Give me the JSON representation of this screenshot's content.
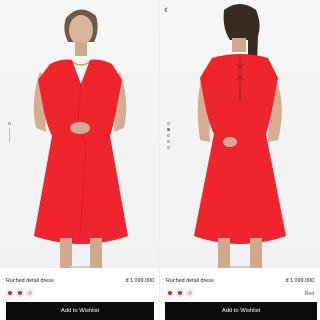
{
  "colors": {
    "dress_red": "#f0242c",
    "button_bg": "#0b0b0b",
    "swatch_red": "#d62828",
    "swatch_beige": "#d9c589"
  },
  "left": {
    "product_name": "Ruched detail dress",
    "price": "đ 1.099.000",
    "button_label": "Add to Wishlist",
    "swatches": [
      "red",
      "red",
      "beige"
    ]
  },
  "right": {
    "back_icon": "chevron-left-icon",
    "product_name": "Ruched detail dress",
    "price": "đ 1.099.000",
    "color_name": "Red",
    "button_label": "Add to Wishlist",
    "swatches": [
      "red",
      "red",
      "beige"
    ]
  }
}
